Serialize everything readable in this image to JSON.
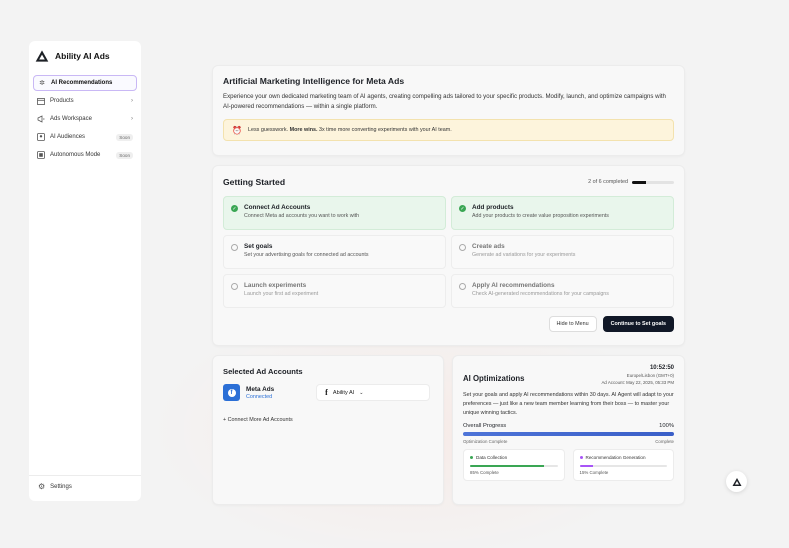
{
  "app": {
    "name": "Ability AI Ads",
    "accent": "#c9b8f5",
    "dark_button": "#111827"
  },
  "sidebar": {
    "items": [
      {
        "label": "AI Recommendations",
        "icon": "sparkle-icon",
        "active": true
      },
      {
        "label": "Products",
        "icon": "box-icon",
        "chevron": true
      },
      {
        "label": "Ads Workspace",
        "icon": "megaphone-icon",
        "chevron": true
      },
      {
        "label": "AI Audiences",
        "icon": "audience-icon",
        "badge": "Soon"
      },
      {
        "label": "Autonomous Mode",
        "icon": "autopilot-icon",
        "badge": "Soon"
      }
    ],
    "settings_label": "Settings"
  },
  "intro": {
    "title": "Artificial Marketing Intelligence for Meta Ads",
    "description": "Experience your own dedicated marketing team of AI agents, creating compelling ads tailored to your specific products. Modify, launch, and optimize campaigns with AI-powered recommendations — within a single platform.",
    "tip_lead": "Less guesswork.",
    "tip_bold": "More wins.",
    "tip_rest": "3x time more converting experiments with your AI team."
  },
  "getting_started": {
    "title": "Getting Started",
    "progress_text": "2 of 6 completed",
    "progress_fraction": 0.333,
    "steps": [
      {
        "title": "Connect Ad Accounts",
        "desc": "Connect Meta ad accounts you want to work with",
        "state": "done"
      },
      {
        "title": "Add products",
        "desc": "Add your products to create value proposition experiments",
        "state": "done"
      },
      {
        "title": "Set goals",
        "desc": "Set your advertising goals for connected ad accounts",
        "state": "todo"
      },
      {
        "title": "Create ads",
        "desc": "Generate ad variations for your experiments",
        "state": "locked"
      },
      {
        "title": "Launch experiments",
        "desc": "Launch your first ad experiment",
        "state": "locked"
      },
      {
        "title": "Apply AI recommendations",
        "desc": "Check AI-generated recommendations for your campaigns",
        "state": "locked"
      }
    ],
    "hide_button": "Hide to Menu",
    "continue_button": "Continue to Set goals"
  },
  "accounts": {
    "title": "Selected Ad Accounts",
    "name": "Meta Ads",
    "status": "Connected",
    "selected_account": "Ability AI",
    "add_more": "+ Connect More Ad Accounts"
  },
  "ai_optimizations": {
    "title": "AI Optimizations",
    "time": "10:52:50",
    "timezone": "Europe/Lisbon (GMT+0)",
    "account_line": "Ad Account: May 22, 2025, 05:33 PM",
    "description": "Set your goals and apply AI recommendations within 30 days. AI Agent will adapt to your preferences — just like a new team member learning from their boss — to master your unique winning tactics.",
    "overall_label": "Overall Progress",
    "overall_value": "100%",
    "overall_fraction": 1.0,
    "start_label": "Optimization Complete",
    "end_label": "Complete",
    "subtasks": [
      {
        "label": "Data Collection",
        "progress_text": "85% Complete",
        "fraction": 0.85,
        "color": "#3aa654"
      },
      {
        "label": "Recommendation Generation",
        "progress_text": "15% Complete",
        "fraction": 0.15,
        "color": "#a855f7"
      }
    ]
  }
}
